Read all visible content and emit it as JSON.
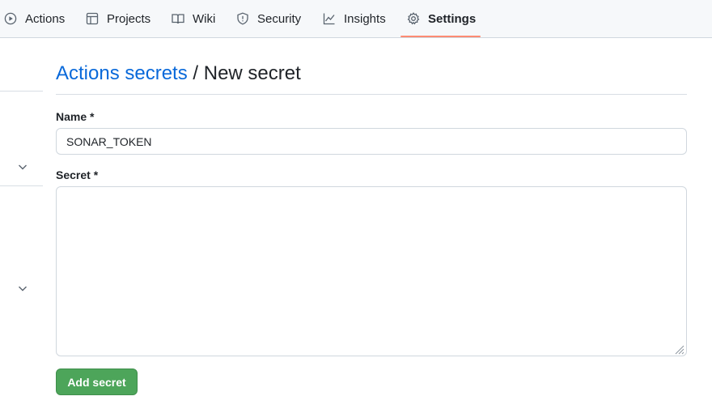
{
  "nav": {
    "tabs": [
      {
        "label": "Actions",
        "icon": "play-circle-icon"
      },
      {
        "label": "Projects",
        "icon": "table-icon"
      },
      {
        "label": "Wiki",
        "icon": "book-icon"
      },
      {
        "label": "Security",
        "icon": "shield-icon"
      },
      {
        "label": "Insights",
        "icon": "graph-icon"
      },
      {
        "label": "Settings",
        "icon": "gear-icon",
        "selected": true
      }
    ],
    "selected_underline_color": "#fd8c73"
  },
  "page": {
    "breadcrumb_link": "Actions secrets",
    "separator": "/",
    "title": "New secret"
  },
  "form": {
    "name_label": "Name *",
    "name_value": "SONAR_TOKEN",
    "secret_label": "Secret *",
    "secret_value": "",
    "submit_label": "Add secret"
  },
  "colors": {
    "link": "#0969da",
    "primary_button": "#4da55a",
    "border": "#d0d7de"
  }
}
